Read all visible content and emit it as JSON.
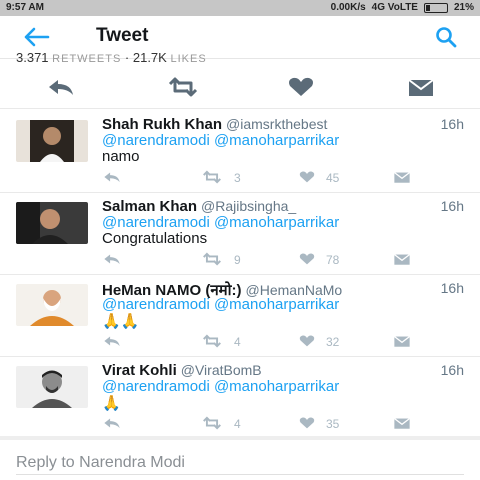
{
  "status": {
    "time": "9:57 AM",
    "net": "0.00K/s",
    "network": "4G VoLTE",
    "battery": "21%"
  },
  "header": {
    "title": "Tweet"
  },
  "stats": {
    "retweets": "3,371",
    "retweets_label": "RETWEETS",
    "likes": "21.7K",
    "likes_label": "LIKES"
  },
  "tweets": [
    {
      "name": "Shah Rukh Khan",
      "handle": "@iamsrkthebest",
      "time": "16h",
      "mentions": "@narendramodi @manoharparrikar",
      "text": "namo",
      "retweets": "3",
      "likes": "45"
    },
    {
      "name": "Salman Khan",
      "handle": "@Rajibsingha_",
      "time": "16h",
      "mentions": "@narendramodi @manoharparrikar",
      "text": "Congratulations",
      "retweets": "9",
      "likes": "78"
    },
    {
      "name": "HeMan NAMO (नमो:)",
      "handle": "@HemanNaMo",
      "time": "16h",
      "mentions": "@narendramodi @manoharparrikar",
      "text": "🙏🙏",
      "retweets": "4",
      "likes": "32"
    },
    {
      "name": "Virat Kohli",
      "handle": "@ViratBomB",
      "time": "16h",
      "mentions": "@narendramodi @manoharparrikar",
      "text": "🙏",
      "retweets": "4",
      "likes": "35"
    }
  ],
  "reply": {
    "placeholder": "Reply to Narendra Modi"
  },
  "colors": {
    "accent": "#1da1f2",
    "icon": "#5b6b78",
    "muted": "#aab8c2"
  }
}
